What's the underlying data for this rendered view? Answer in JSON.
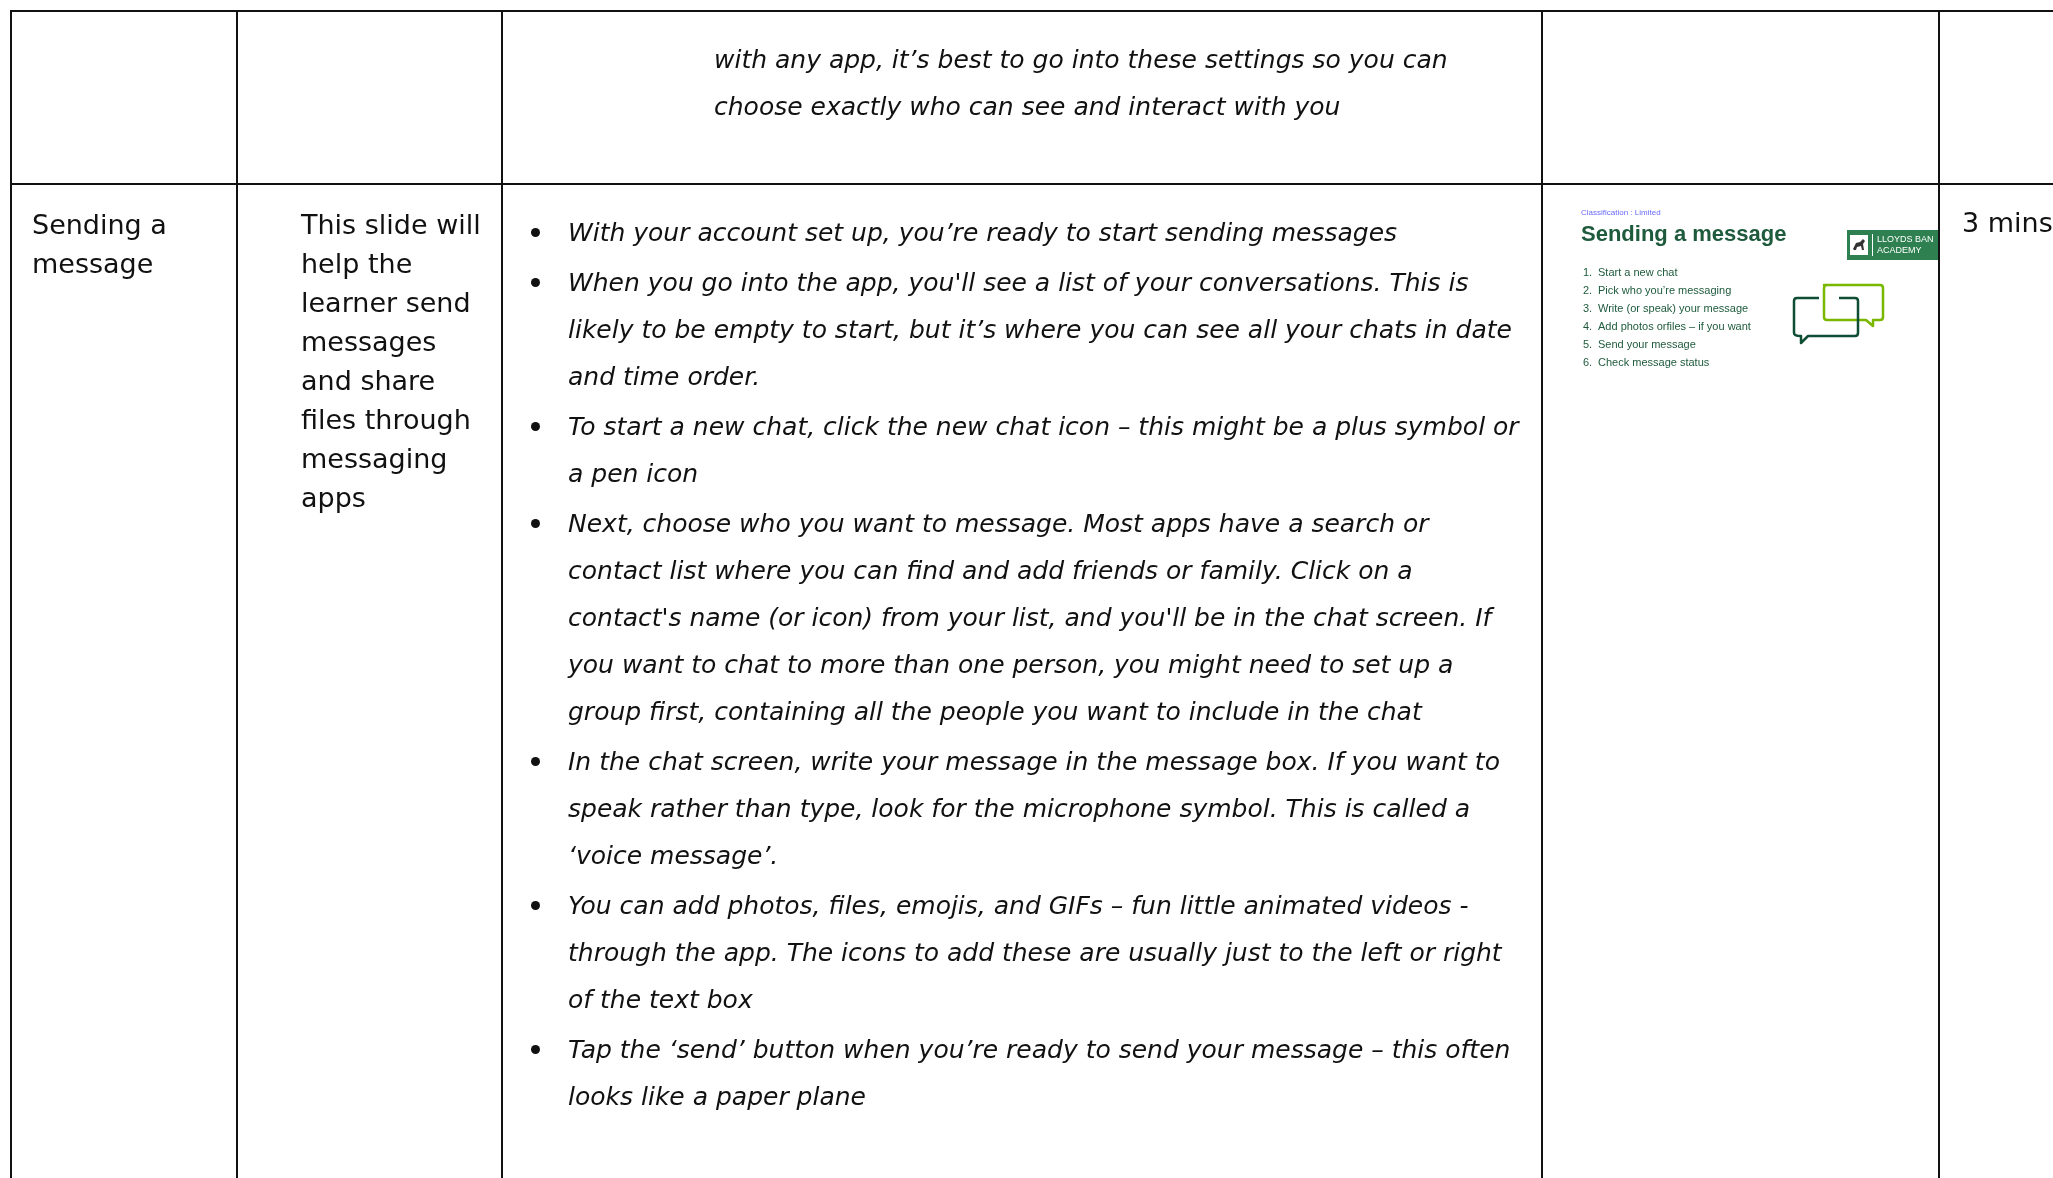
{
  "table": {
    "rows": [
      {
        "column_3": {
          "kind": "paragraph",
          "lines": [
            "with any app, it’s best to go into these settings so you can",
            "choose exactly who can see and interact with you"
          ]
        }
      },
      {
        "column_1": "Sending a message",
        "column_2": "This slide will help the learner send messages and share files through messaging apps",
        "column_3": {
          "kind": "bullets",
          "items": [
            "With your account set up, you’re ready to start sending messages",
            "When you go into the app, you'll see a list of your conversations. This is likely to be empty to start, but it’s where you can see all your chats in date and time order.",
            "To start a new chat, click the new chat icon – this might be a plus symbol or a pen icon",
            "Next, choose who you want to message. Most apps have a search or contact list where you can find and add friends or family. Click on a contact's name (or icon) from your list, and you'll be in the chat screen. If you want to chat to more than one person, you might need to set up a group first, containing all the people you want to include in the chat",
            "In the chat screen, write your message in the message box. If you want to speak rather than type, look for the microphone symbol. This is called a ‘voice message’.",
            "You can add photos, files, emojis, and GIFs – fun little animated videos - through the app. The icons to add these are usually just to the left or right of the text box",
            "Tap the ‘send’ button when you’re ready to send your message – this often looks like a paper plane"
          ]
        },
        "column_4": {
          "slide": {
            "classification": "Classification : Limited",
            "title": "Sending a message",
            "logo": {
              "line_1": "LLOYDS BAN",
              "line_2": "ACADEMY"
            },
            "steps": [
              {
                "number": "1.",
                "text": "Start a new chat"
              },
              {
                "number": "2.",
                "text": "Pick who you’re messaging"
              },
              {
                "number": "3.",
                "text": "Write (or speak) your message"
              },
              {
                "number": "4.",
                "text": "Add photos orfiles – if you want"
              },
              {
                "number": "5.",
                "text": "Send your message"
              },
              {
                "number": "6.",
                "text": "Check message status"
              }
            ]
          }
        },
        "column_5": "3 mins"
      }
    ]
  }
}
